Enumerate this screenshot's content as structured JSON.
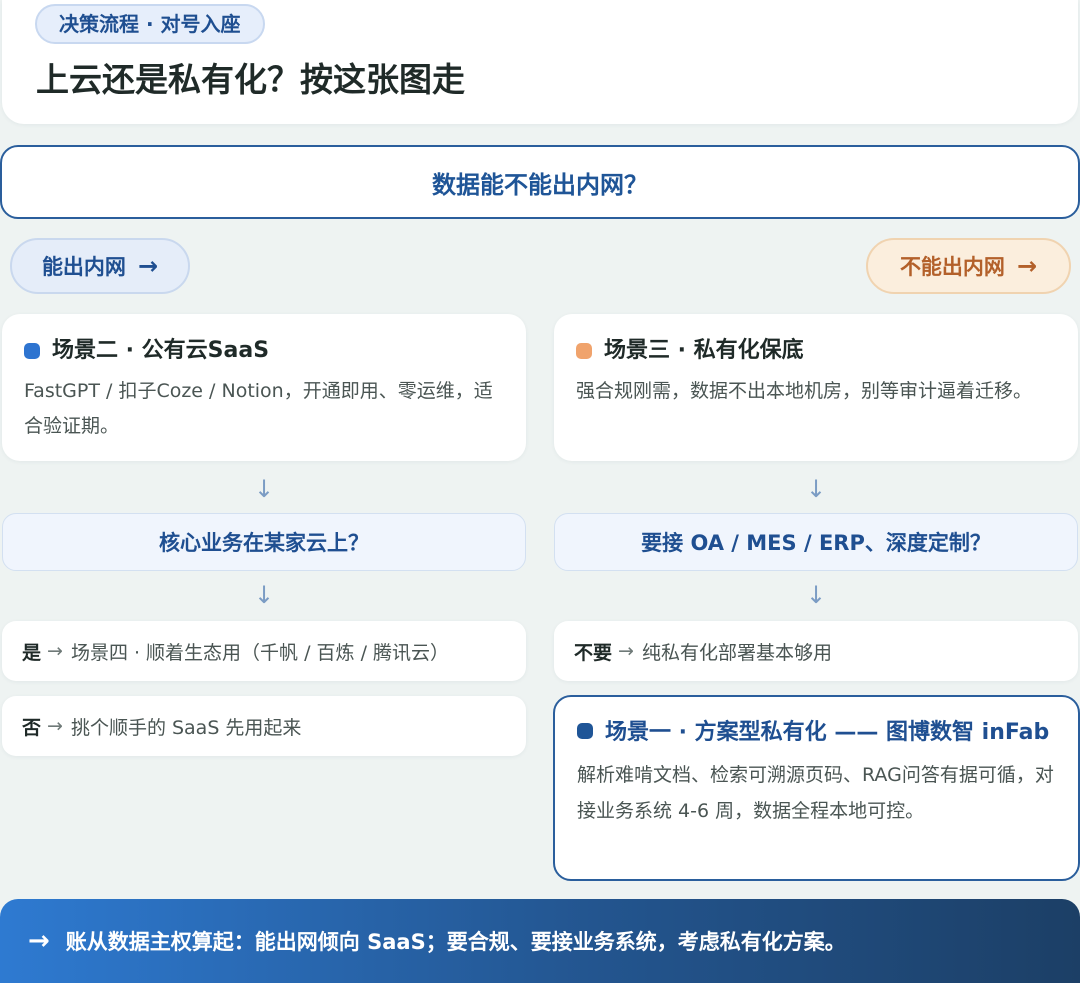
{
  "header": {
    "tag": "决策流程 · 对号入座",
    "title": "上云还是私有化？按这张图走"
  },
  "root_question": "数据能不能出内网？",
  "branches": {
    "left": {
      "label": "能出内网",
      "arrow": "→"
    },
    "right": {
      "label": "不能出内网",
      "arrow": "→"
    }
  },
  "arrows": {
    "down": "↓",
    "right": "→"
  },
  "left": {
    "scenario": {
      "title": "场景二 · 公有云SaaS",
      "desc": "FastGPT / 扣子Coze / Notion，开通即用、零运维，适合验证期。"
    },
    "question": "核心业务在某家云上？",
    "answers": [
      {
        "key": "是",
        "text": "场景四 · 顺着生态用（千帆 / 百炼 / 腾讯云）"
      },
      {
        "key": "否",
        "text": "挑个顺手的 SaaS 先用起来"
      }
    ]
  },
  "right": {
    "scenario": {
      "title": "场景三 · 私有化保底",
      "desc": "强合规刚需，数据不出本地机房，别等审计逼着迁移。"
    },
    "question": "要接 OA / MES / ERP、深度定制？",
    "answers": [
      {
        "key": "不要",
        "text": "纯私有化部署基本够用"
      }
    ],
    "final": {
      "title": "场景一 · 方案型私有化 —— 图博数智 inFab",
      "desc": "解析难啃文档、检索可溯源页码、RAG问答有据可循，对接业务系统 4-6 周，数据全程本地可控。"
    }
  },
  "footer": {
    "arrow": "→",
    "text": "账从数据主权算起：能出网倾向 SaaS；要合规、要接业务系统，考虑私有化方案。"
  },
  "colors": {
    "primary_blue": "#2a5e9c",
    "dot_blue": "#2e74d0",
    "dot_orange": "#f0a36c",
    "dot_final": "#1f5597"
  }
}
